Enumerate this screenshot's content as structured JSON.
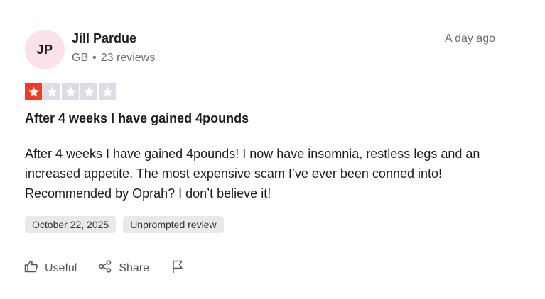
{
  "review": {
    "avatar_initials": "JP",
    "reviewer_name": "Jill Pardue",
    "country": "GB",
    "separator": "•",
    "review_count": "23 reviews",
    "date_relative": "A day ago",
    "rating": 1,
    "rating_max": 5,
    "colors": {
      "star_filled": "#ff3722",
      "star_empty": "#dcdce6",
      "avatar_bg": "#fbe2ea"
    },
    "title": "After 4 weeks I have gained 4pounds",
    "body": "After 4 weeks I have gained 4pounds! I now have insomnia, restless legs and an increased appetite. The most expensive scam I’ve ever been conned into! Recommended by Oprah? I don’t believe it!",
    "date_experience": "October 22, 2025",
    "review_type": "Unprompted review"
  },
  "actions": {
    "useful_label": "Useful",
    "useful_icon": "thumbs-up-icon",
    "share_label": "Share",
    "share_icon": "share-icon",
    "flag_icon": "flag-icon"
  }
}
